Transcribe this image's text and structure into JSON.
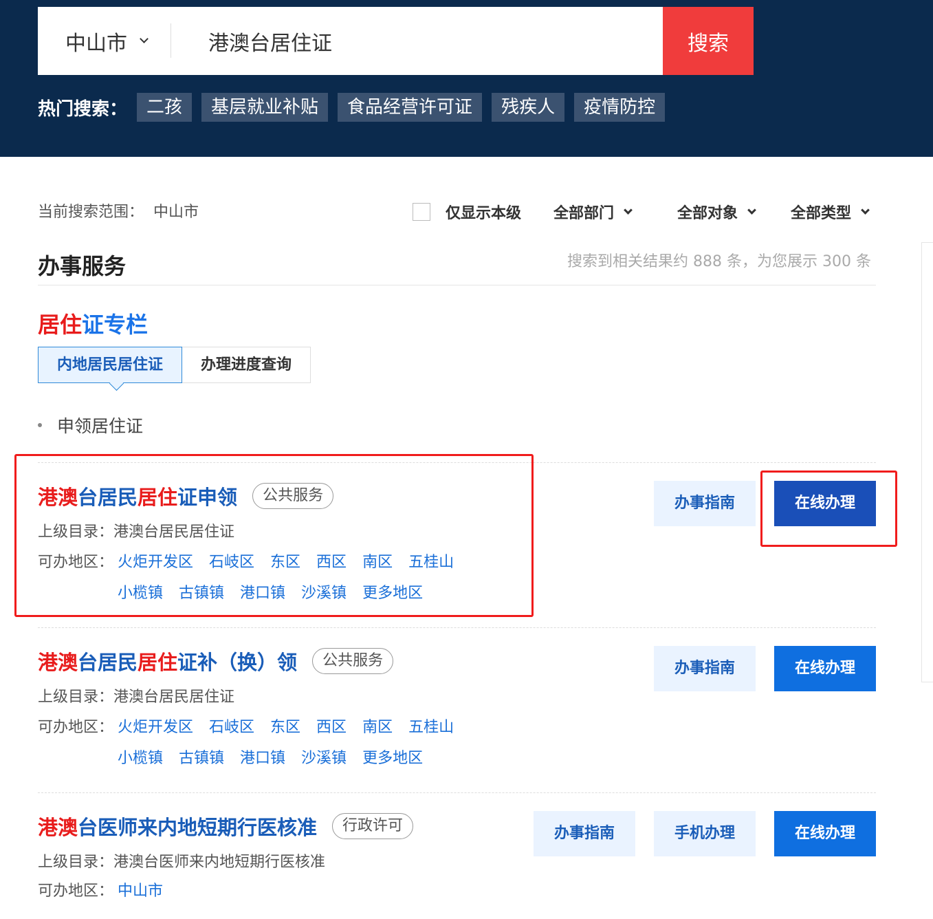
{
  "search": {
    "city": "中山市",
    "query": "港澳台居住证",
    "button_label": "搜索"
  },
  "hot_search": {
    "label": "热门搜索：",
    "tags": [
      "二孩",
      "基层就业补贴",
      "食品经营许可证",
      "残疾人",
      "疫情防控"
    ]
  },
  "filters": {
    "scope_label": "当前搜索范围：",
    "scope_value": "中山市",
    "only_level_label": "仅显示本级",
    "department": "全部部门",
    "target": "全部对象",
    "type": "全部类型"
  },
  "section": {
    "title": "办事服务",
    "result_count": "搜索到相关结果约 888 条，为您展示 300 条"
  },
  "column": {
    "title_red": "居住",
    "title_blue": "证专栏",
    "tabs": [
      "内地居民居住证",
      "办理进度查询"
    ],
    "sub_item": "申领居住证"
  },
  "colors": {
    "header_bg": "#0b2a4d",
    "search_button": "#f03c3c",
    "highlight_red": "#e81c1c",
    "link_blue": "#1a6fd8",
    "primary_button": "#0f6fe0",
    "annotation_box": "#f01c1c"
  },
  "results": [
    {
      "title_parts": [
        {
          "text": "港澳",
          "hl": true
        },
        {
          "text": "台居民",
          "hl": false
        },
        {
          "text": "居住",
          "hl": true
        },
        {
          "text": "证申领",
          "hl": false
        }
      ],
      "tag": "公共服务",
      "parent_label": "上级目录：",
      "parent_value": "港澳台居民居住证",
      "area_label": "可办地区：",
      "areas_row1": [
        "火炬开发区",
        "石岐区",
        "东区",
        "西区",
        "南区",
        "五桂山"
      ],
      "areas_row2": [
        "小榄镇",
        "古镇镇",
        "港口镇",
        "沙溪镇",
        "更多地区"
      ],
      "guide_label": "办事指南",
      "online_label": "在线办理"
    },
    {
      "title_parts": [
        {
          "text": "港澳",
          "hl": true
        },
        {
          "text": "台居民",
          "hl": false
        },
        {
          "text": "居住",
          "hl": true
        },
        {
          "text": "证补（换）领",
          "hl": false
        }
      ],
      "tag": "公共服务",
      "parent_label": "上级目录：",
      "parent_value": "港澳台居民居住证",
      "area_label": "可办地区：",
      "areas_row1": [
        "火炬开发区",
        "石岐区",
        "东区",
        "西区",
        "南区",
        "五桂山"
      ],
      "areas_row2": [
        "小榄镇",
        "古镇镇",
        "港口镇",
        "沙溪镇",
        "更多地区"
      ],
      "guide_label": "办事指南",
      "online_label": "在线办理"
    },
    {
      "title_parts": [
        {
          "text": "港澳",
          "hl": true
        },
        {
          "text": "台医师来内地短期行医核准",
          "hl": false
        }
      ],
      "tag": "行政许可",
      "parent_label": "上级目录：",
      "parent_value": "港澳台医师来内地短期行医核准",
      "area_label": "可办地区：",
      "areas_row1": [
        "中山市"
      ],
      "guide_label": "办事指南",
      "mobile_label": "手机办理",
      "online_label": "在线办理"
    }
  ]
}
